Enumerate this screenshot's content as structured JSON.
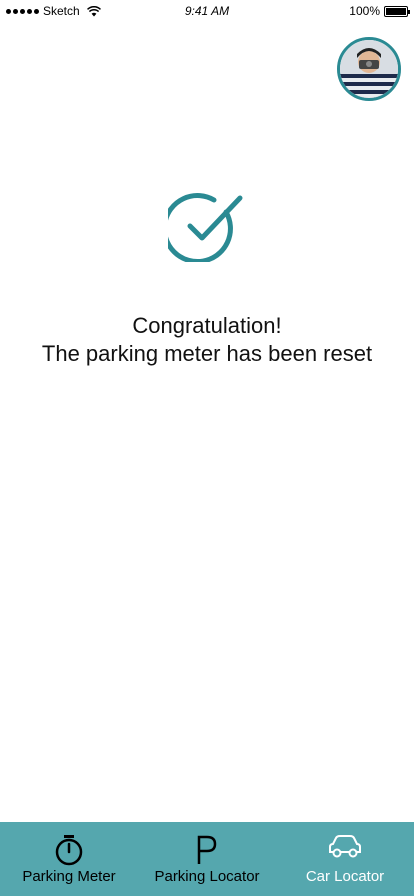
{
  "status_bar": {
    "carrier": "Sketch",
    "time": "9:41 AM",
    "battery": "100%"
  },
  "profile": {
    "avatar_icon": "user-avatar"
  },
  "confirmation": {
    "icon": "check-circle-icon",
    "title": "Congratulation!",
    "message": "The parking meter has been reset"
  },
  "tab_bar": {
    "tabs": [
      {
        "label": "Parking Meter",
        "icon": "stopwatch-icon",
        "active": false
      },
      {
        "label": "Parking Locator",
        "icon": "parking-p-icon",
        "active": false
      },
      {
        "label": "Car Locator",
        "icon": "car-icon",
        "active": true
      }
    ]
  },
  "colors": {
    "accent": "#2a8a93",
    "tab_bar_bg": "#55a7ae"
  }
}
